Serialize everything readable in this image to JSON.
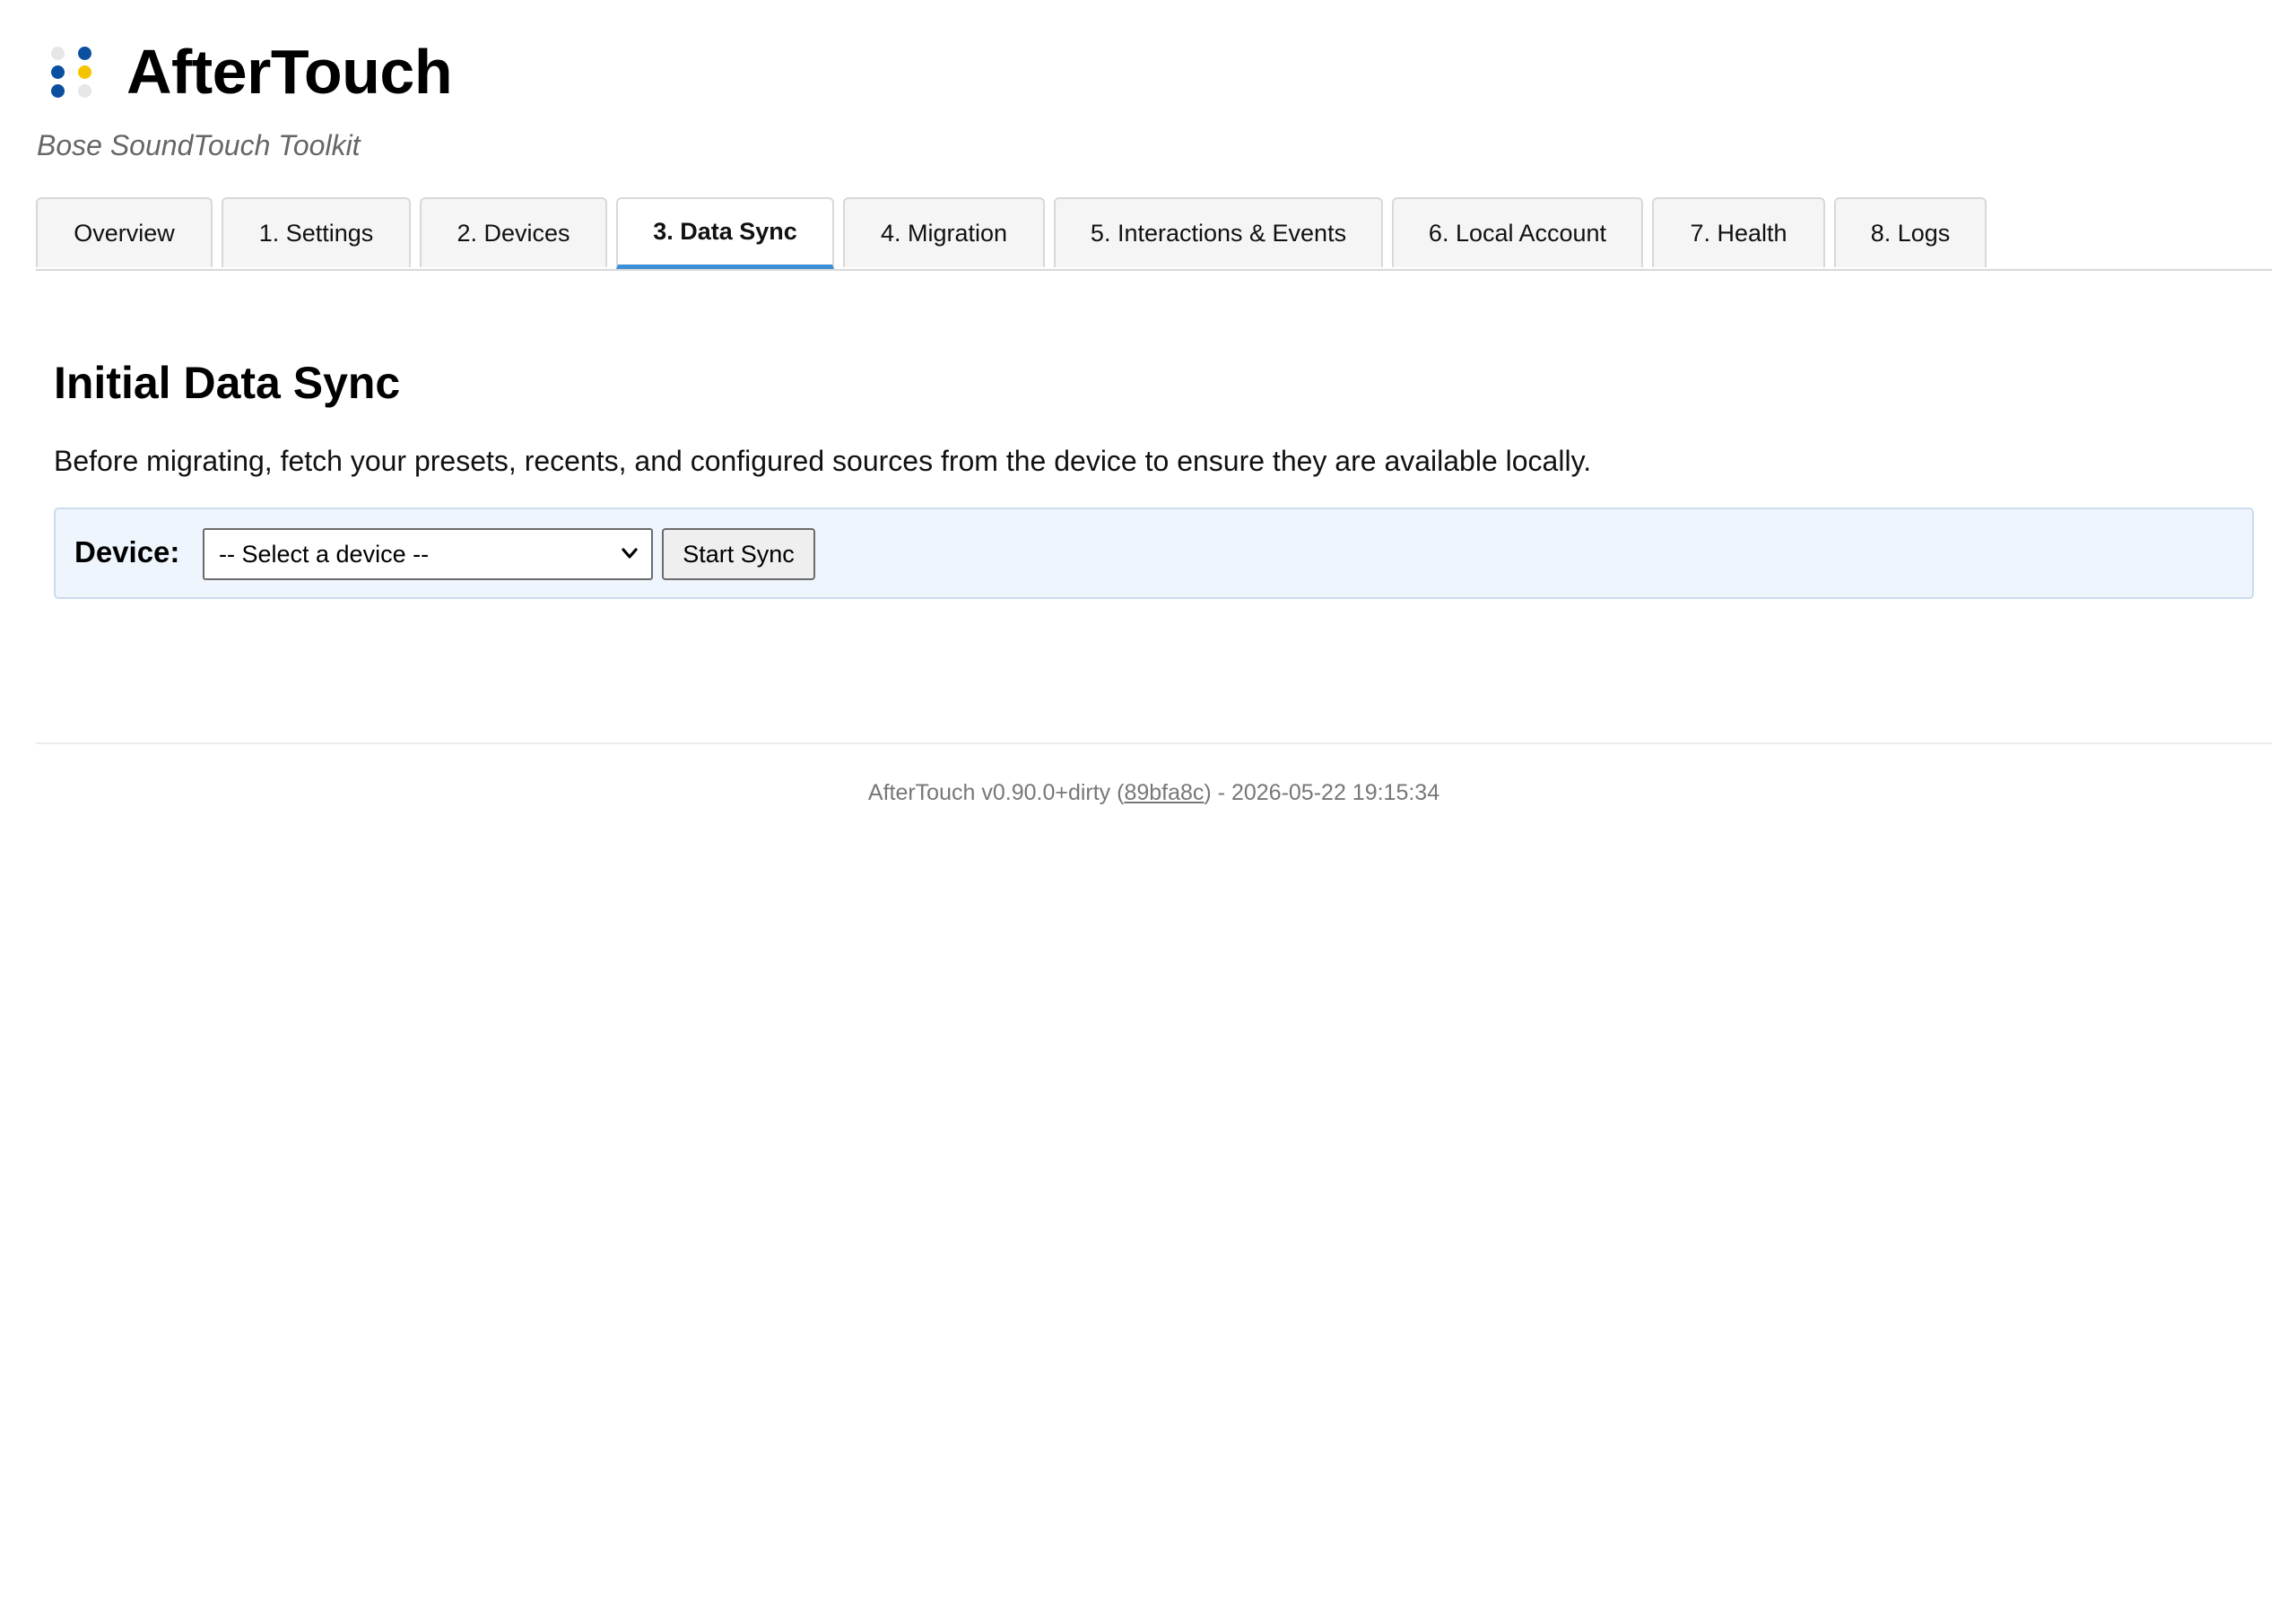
{
  "app": {
    "title": "AfterTouch",
    "subtitle": "Bose SoundTouch Toolkit",
    "logo_colors": {
      "blue": "#0b4fa0",
      "yellow": "#f5c400",
      "grey": "#e6e6e6"
    }
  },
  "tabs": [
    {
      "label": "Overview",
      "active": false
    },
    {
      "label": "1. Settings",
      "active": false
    },
    {
      "label": "2. Devices",
      "active": false
    },
    {
      "label": "3. Data Sync",
      "active": true
    },
    {
      "label": "4. Migration",
      "active": false
    },
    {
      "label": "5. Interactions & Events",
      "active": false
    },
    {
      "label": "6. Local Account",
      "active": false
    },
    {
      "label": "7. Health",
      "active": false
    },
    {
      "label": "8. Logs",
      "active": false
    }
  ],
  "main": {
    "title": "Initial Data Sync",
    "description": "Before migrating, fetch your presets, recents, and configured sources from the device to ensure they are available locally.",
    "device_label": "Device:",
    "device_select_value": "-- Select a device --",
    "start_button": "Start Sync"
  },
  "footer": {
    "version": "AfterTouch v0.90.0+dirty (",
    "commit": "89bfa8c",
    "build_time": ") - 2026-05-22 19:15:34"
  },
  "colors": {
    "active_tab_accent": "#3d8fd6",
    "panel_background": "#eef5fd",
    "panel_border": "#c9dcee"
  }
}
